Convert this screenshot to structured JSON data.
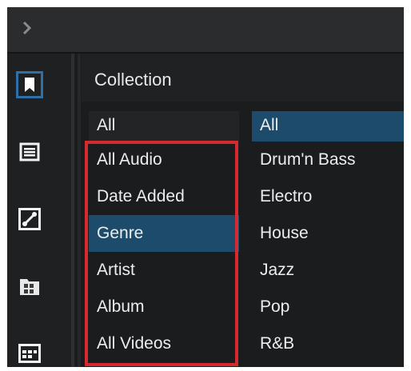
{
  "collection": {
    "title": "Collection",
    "categories": [
      {
        "label": "All",
        "selected": false
      },
      {
        "label": "All Audio",
        "selected": false
      },
      {
        "label": "Date Added",
        "selected": false
      },
      {
        "label": "Genre",
        "selected": true
      },
      {
        "label": "Artist",
        "selected": false
      },
      {
        "label": "Album",
        "selected": false
      },
      {
        "label": "All Videos",
        "selected": false
      }
    ],
    "values": [
      {
        "label": "All",
        "selected": true
      },
      {
        "label": "Drum'n Bass",
        "selected": false
      },
      {
        "label": "Electro",
        "selected": false
      },
      {
        "label": "House",
        "selected": false
      },
      {
        "label": "Jazz",
        "selected": false
      },
      {
        "label": "Pop",
        "selected": false
      },
      {
        "label": "R&B",
        "selected": false
      }
    ]
  },
  "sidebar": {
    "icons": [
      "bookmark-icon",
      "list-icon",
      "link-icon",
      "folder-grid-icon",
      "grid-icon"
    ],
    "active": "bookmark-icon"
  },
  "colors": {
    "selection": "#1d4b6c",
    "highlight_box": "#d42a30",
    "active_icon_border": "#2d6fa6"
  }
}
